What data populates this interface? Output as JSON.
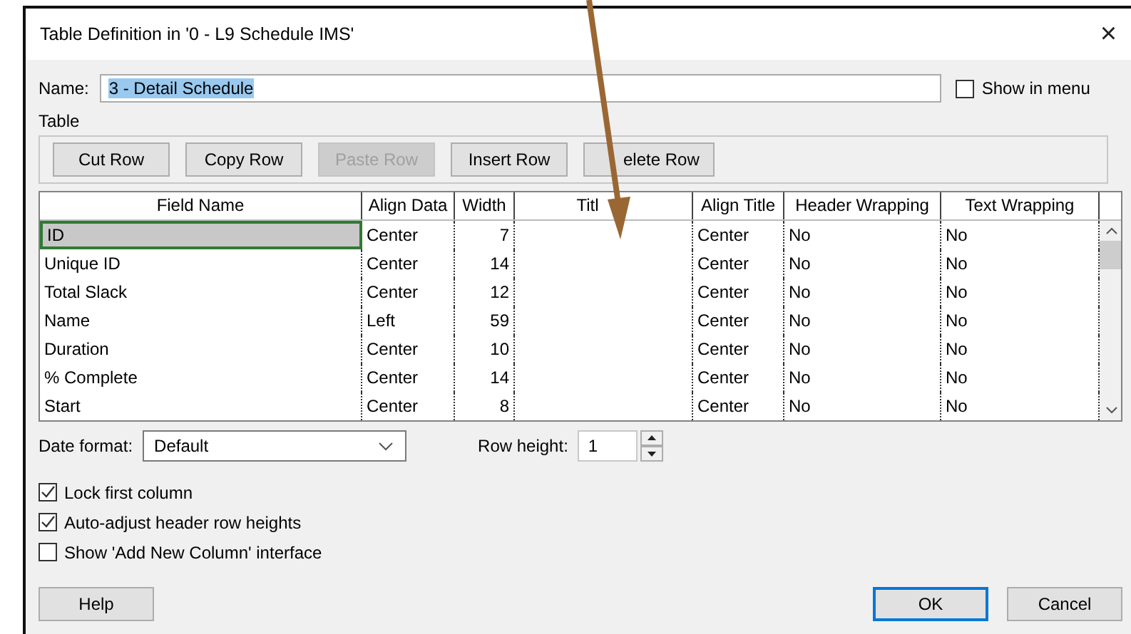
{
  "window": {
    "title": "Table Definition in '0 - L9 Schedule IMS'",
    "close": "×"
  },
  "name_field": {
    "label": "Name:",
    "value": "3 - Detail Schedule",
    "text_selected": true
  },
  "show_in_menu": {
    "label": "Show in menu",
    "checked": false
  },
  "table_group": {
    "label": "Table"
  },
  "row_buttons": [
    {
      "label": "Cut Row",
      "disabled": false
    },
    {
      "label": "Copy Row",
      "disabled": false
    },
    {
      "label": "Paste Row",
      "disabled": true
    },
    {
      "label": "Insert Row",
      "disabled": false
    },
    {
      "label": "elete Row",
      "disabled": false
    }
  ],
  "table": {
    "columns": [
      "Field Name",
      "Align Data",
      "Width",
      "Titl",
      "Align Title",
      "Header Wrapping",
      "Text Wrapping"
    ],
    "rows": [
      {
        "cells": [
          "ID",
          "Center",
          "7",
          "",
          "Center",
          "No",
          "No"
        ],
        "selected": true
      },
      {
        "cells": [
          "Unique ID",
          "Center",
          "14",
          "",
          "Center",
          "No",
          "No"
        ],
        "selected": false
      },
      {
        "cells": [
          "Total Slack",
          "Center",
          "12",
          "",
          "Center",
          "No",
          "No"
        ],
        "selected": false
      },
      {
        "cells": [
          "Name",
          "Left",
          "59",
          "",
          "Center",
          "No",
          "No"
        ],
        "selected": false
      },
      {
        "cells": [
          "Duration",
          "Center",
          "10",
          "",
          "Center",
          "No",
          "No"
        ],
        "selected": false
      },
      {
        "cells": [
          "% Complete",
          "Center",
          "14",
          "",
          "Center",
          "No",
          "No"
        ],
        "selected": false
      },
      {
        "cells": [
          "Start",
          "Center",
          "8",
          "",
          "Center",
          "No",
          "No"
        ],
        "selected": false
      }
    ]
  },
  "date_format": {
    "label": "Date format:",
    "value": "Default"
  },
  "row_height": {
    "label": "Row height:",
    "value": "1"
  },
  "options": [
    {
      "label": "Lock first column",
      "checked": true
    },
    {
      "label": "Auto-adjust header row heights",
      "checked": true
    },
    {
      "label": "Show 'Add New Column' interface",
      "checked": false
    }
  ],
  "help_button": {
    "label": "Help"
  },
  "dialog_buttons": [
    {
      "label": "OK",
      "default": true
    },
    {
      "label": "Cancel",
      "default": false
    }
  ]
}
